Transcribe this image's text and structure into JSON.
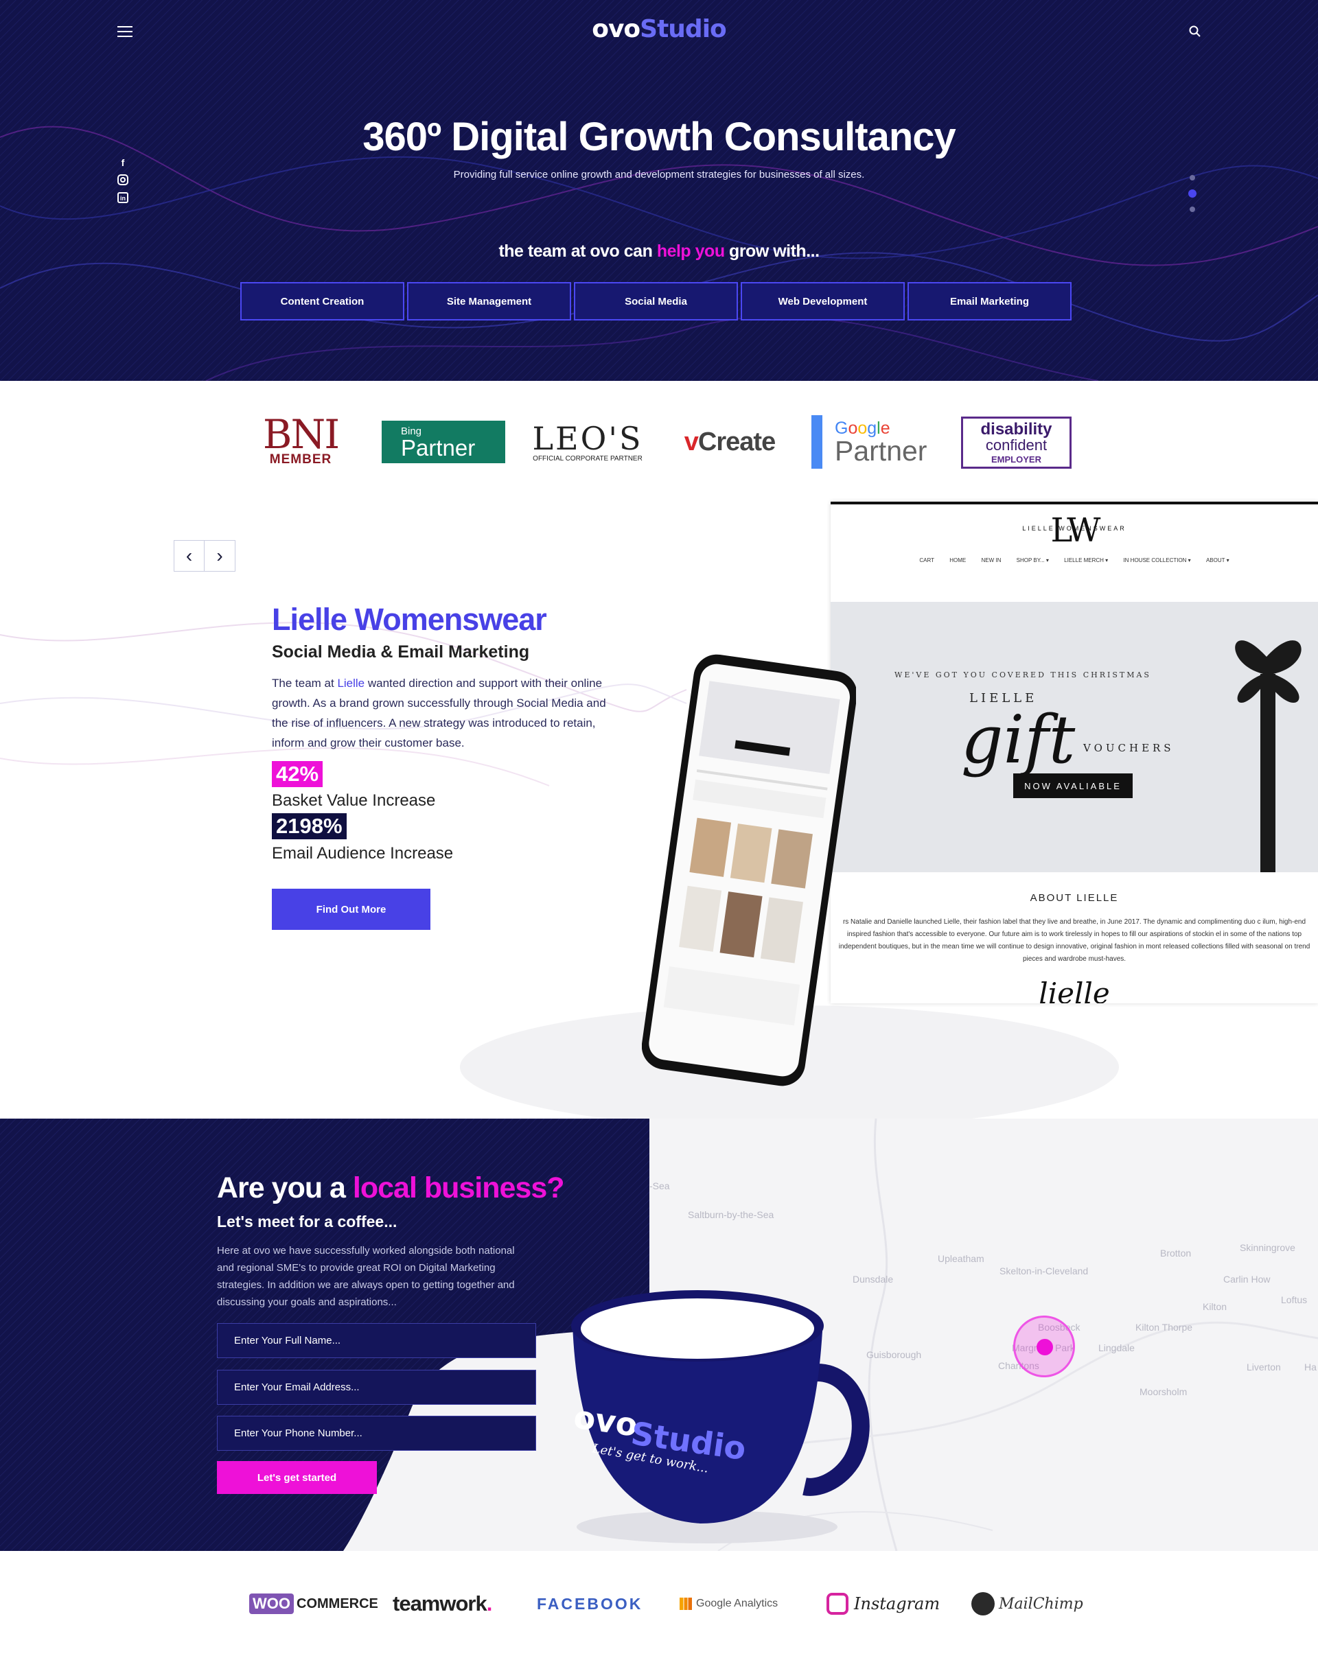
{
  "header": {
    "logo_part1": "ovo",
    "logo_part2": "Studio",
    "menu_icon": "hamburger-menu-icon",
    "search_icon": "search-icon",
    "social_icons": [
      "facebook-icon",
      "instagram-icon",
      "linkedin-icon"
    ]
  },
  "hero": {
    "title": "360º Digital Growth Consultancy",
    "subtitle": "Providing full service online growth and development strategies for businesses of all sizes.",
    "tagline_before": "the team at ovo can ",
    "tagline_highlight": "help you",
    "tagline_after": " grow with...",
    "services": [
      "Content Creation",
      "Site Management",
      "Social Media",
      "Web Development",
      "Email Marketing"
    ],
    "active_slide": 2,
    "slide_count": 3
  },
  "partners": {
    "bni_line1": "BNI",
    "bni_line2": "MEMBER",
    "bing_small": "Bing",
    "bing_large": "Partner",
    "leos_large": "LEO'S",
    "leos_small": "OFFICIAL CORPORATE PARTNER",
    "vcreate_v": "v",
    "vcreate_rest": "Create",
    "google_small": "Google",
    "google_large": "Partner",
    "disability_1": "disability",
    "disability_2": "confident",
    "disability_3": "EMPLOYER"
  },
  "case_study": {
    "prev_label": "‹",
    "next_label": "›",
    "title": "Lielle Womenswear",
    "subtitle": "Social Media & Email Marketing",
    "text_before": "The team at ",
    "text_link": "Lielle",
    "text_after": " wanted direction and support with their online growth. As a brand grown successfully through Social Media and the rise of influencers. A new strategy was introduced to retain, inform and grow their customer base.",
    "stat1_value": "42%",
    "stat1_label": "Basket Value Increase",
    "stat2_value": "2198%",
    "stat2_label": "Email Audience Increase",
    "cta": "Find Out More"
  },
  "site_mock": {
    "logo": "LW",
    "brand": "LIELLE WOMENSWEAR",
    "nav": [
      "CART",
      "HOME",
      "NEW IN",
      "SHOP BY... ▾",
      "LIELLE MERCH ▾",
      "IN HOUSE COLLECTION ▾",
      "ABOUT ▾"
    ],
    "banner_line1": "WE'VE GOT YOU COVERED THIS CHRISTMAS",
    "banner_line2": "LIELLE",
    "banner_script": "gift",
    "banner_line3": "VOUCHERS",
    "banner_button": "NOW AVALIABLE",
    "about_title": "ABOUT LIELLE",
    "about_text": "rs Natalie and Danielle launched Lielle, their fashion label that they live and breathe, in June 2017. The dynamic and complimenting duo c ilum, high-end inspired fashion that's accessible to everyone. Our future aim is to work tirelessly in hopes to fill our aspirations of stockin el in some of the nations top independent boutiques, but in the mean time we will continue to design innovative, original fashion in mont released collections filled with seasonal on trend pieces and wardrobe must-haves.",
    "signature": "lielle"
  },
  "local": {
    "title_before": "Are you a ",
    "title_highlight": "local business?",
    "subtitle": "Let's meet for a coffee...",
    "text": "Here at ovo we have successfully worked alongside both national and regional SME's to provide great ROI on Digital Marketing strategies. In addition we are always open to getting together and discussing your goals and aspirations...",
    "name_placeholder": "Enter Your Full Name...",
    "email_placeholder": "Enter Your Email Address...",
    "phone_placeholder": "Enter Your Phone Number...",
    "cta": "Let's get started",
    "mug_logo1": "ovo",
    "mug_logo2": "Studio",
    "mug_tagline": "Let's get to work...",
    "map_labels": [
      "-Sea",
      "Saltburn-by-the-Sea",
      "Brotton",
      "Skinningrove",
      "Upleatham",
      "Dunsdale",
      "Skelton-in-Cleveland",
      "Carlin How",
      "Kilton",
      "Loftus",
      "Boosbeck",
      "Kilton Thorpe",
      "Guisborough",
      "Margrove Park",
      "Lingdale",
      "Charltons",
      "Liverton",
      "Moorsholm",
      "Ha"
    ]
  },
  "tools": {
    "woo_1": "WOO",
    "woo_2": "COMMERCE",
    "teamwork": "teamwork",
    "teamwork_dot": ".",
    "facebook": "FACEBOOK",
    "google_analytics": "Google Analytics",
    "instagram": "Instagram",
    "mailchimp": "MailChimp"
  },
  "colors": {
    "hero_bg": "#12134a",
    "accent_blue": "#4841e6",
    "accent_pink": "#ee11d8"
  }
}
